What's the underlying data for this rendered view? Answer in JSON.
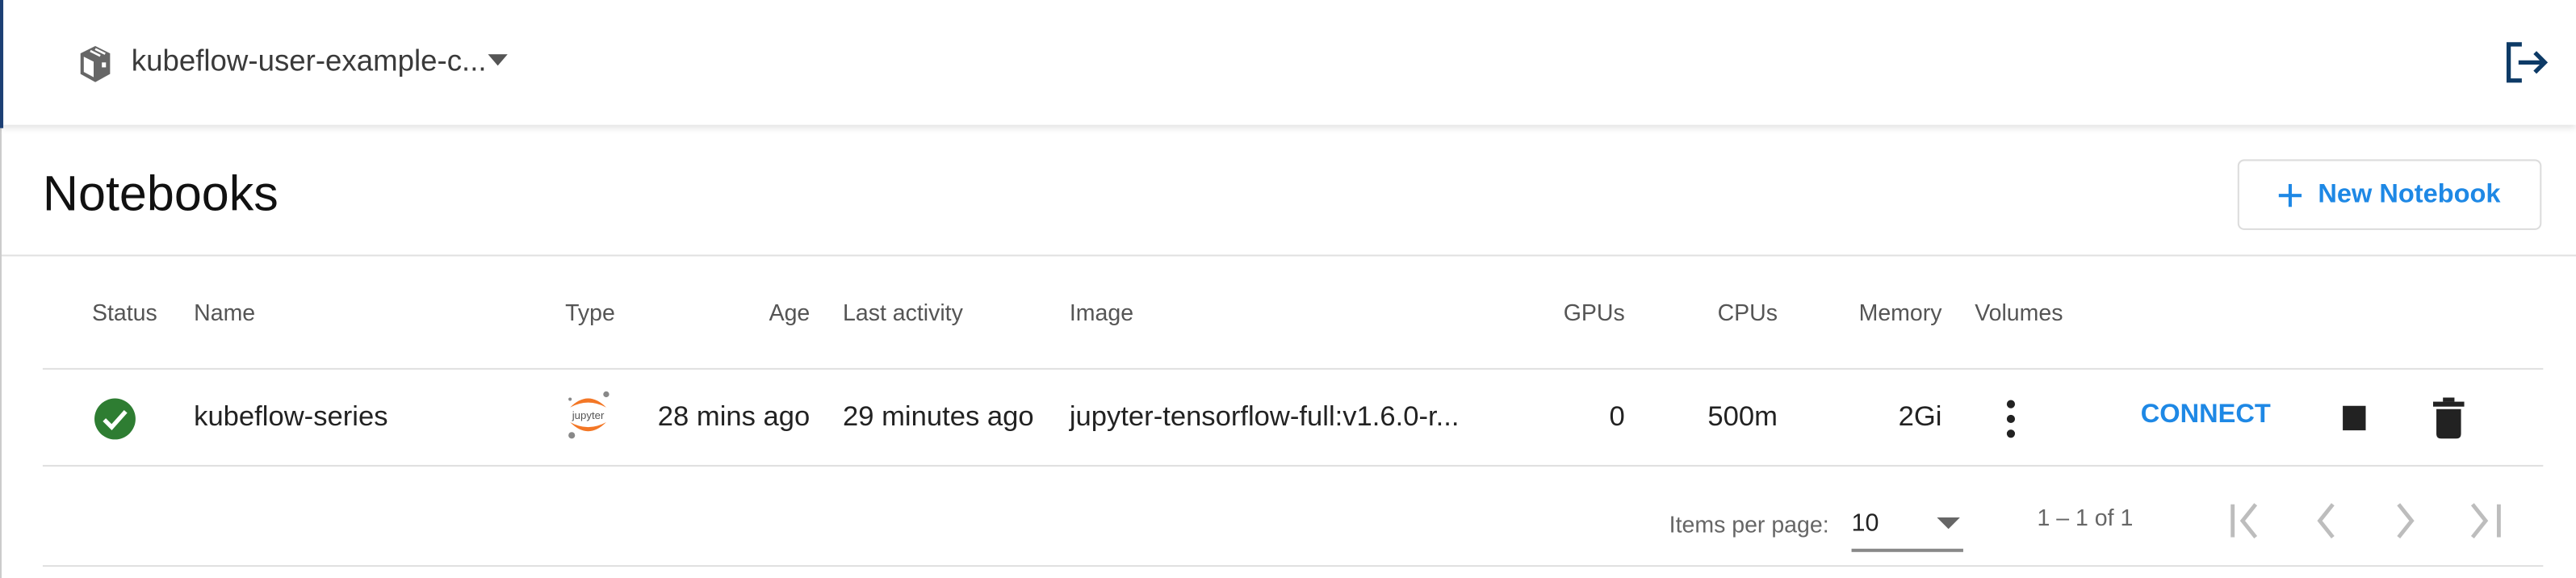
{
  "header": {
    "namespace": "kubeflow-user-example-c...",
    "namespace_icon": "cube-icon",
    "logout_icon": "logout-icon",
    "accent_color": "#1c3f74"
  },
  "page": {
    "title": "Notebooks",
    "new_button_label": "New Notebook",
    "new_button_icon": "plus-icon",
    "accent_color": "#1e88e5"
  },
  "table": {
    "columns": [
      "Status",
      "Name",
      "Type",
      "Age",
      "Last activity",
      "Image",
      "GPUs",
      "CPUs",
      "Memory",
      "Volumes"
    ],
    "rows": [
      {
        "status": "ready",
        "status_color": "#2e7d32",
        "name": "kubeflow-series",
        "type": "jupyter",
        "type_icon_text": "jupyter",
        "age": "28 mins ago",
        "last_activity": "29 minutes ago",
        "image": "jupyter-tensorflow-full:v1.6.0-r...",
        "gpus": "0",
        "cpus": "500m",
        "memory": "2Gi",
        "connect_label": "CONNECT"
      }
    ]
  },
  "paginator": {
    "items_per_page_label": "Items per page:",
    "items_per_page": "10",
    "range_label": "1 – 1 of 1"
  }
}
